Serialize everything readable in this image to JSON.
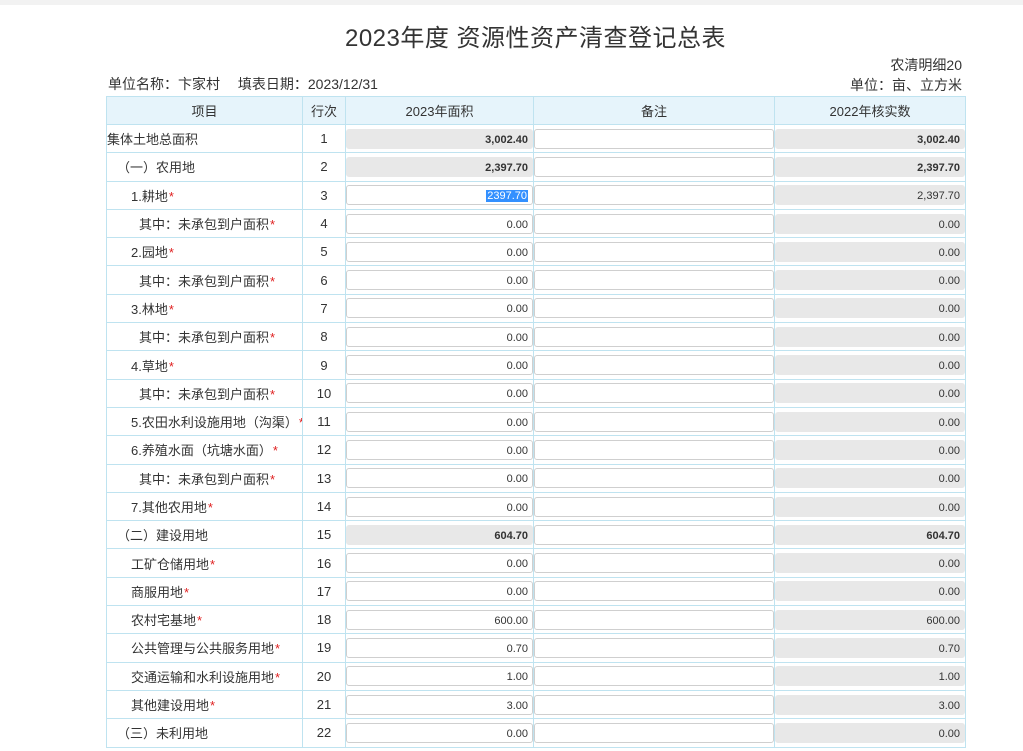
{
  "title": "2023年度 资源性资产清查登记总表",
  "form_code": "农清明细20",
  "unit_label": "单位：亩、立方米",
  "unit_name": "单位名称：卞家村",
  "fill_date": "填表日期：2023/12/31",
  "columns": [
    "项目",
    "行次",
    "2023年面积",
    "备注",
    "2022年核实数"
  ],
  "colors": {
    "header_bg": "#e6f4fb",
    "border": "#bfe3f0",
    "required_star": "#e02020",
    "selection": "#3390ff"
  },
  "rows": [
    {
      "label": "集体土地总面积",
      "level": 0,
      "required": false,
      "line": "1",
      "area": "3,002.40",
      "area_ro": true,
      "bold": true,
      "note": "",
      "prev": "3,002.40"
    },
    {
      "label": "（一）农用地",
      "level": 1,
      "required": false,
      "line": "2",
      "area": "2,397.70",
      "area_ro": true,
      "bold": true,
      "note": "",
      "prev": "2,397.70"
    },
    {
      "label": "1.耕地",
      "level": 2,
      "required": true,
      "line": "3",
      "area": "2397.70",
      "area_ro": false,
      "bold": false,
      "selected": true,
      "note": "",
      "prev": "2,397.70"
    },
    {
      "label": "其中：未承包到户面积",
      "level": 3,
      "required": true,
      "line": "4",
      "area": "0.00",
      "area_ro": false,
      "bold": false,
      "note": "",
      "prev": "0.00"
    },
    {
      "label": "2.园地",
      "level": 2,
      "required": true,
      "line": "5",
      "area": "0.00",
      "area_ro": false,
      "bold": false,
      "note": "",
      "prev": "0.00"
    },
    {
      "label": "其中：未承包到户面积",
      "level": 3,
      "required": true,
      "line": "6",
      "area": "0.00",
      "area_ro": false,
      "bold": false,
      "note": "",
      "prev": "0.00"
    },
    {
      "label": "3.林地",
      "level": 2,
      "required": true,
      "line": "7",
      "area": "0.00",
      "area_ro": false,
      "bold": false,
      "note": "",
      "prev": "0.00"
    },
    {
      "label": "其中：未承包到户面积",
      "level": 3,
      "required": true,
      "line": "8",
      "area": "0.00",
      "area_ro": false,
      "bold": false,
      "note": "",
      "prev": "0.00"
    },
    {
      "label": "4.草地",
      "level": 2,
      "required": true,
      "line": "9",
      "area": "0.00",
      "area_ro": false,
      "bold": false,
      "note": "",
      "prev": "0.00"
    },
    {
      "label": "其中：未承包到户面积",
      "level": 3,
      "required": true,
      "line": "10",
      "area": "0.00",
      "area_ro": false,
      "bold": false,
      "note": "",
      "prev": "0.00"
    },
    {
      "label": "5.农田水利设施用地（沟渠）",
      "level": 2,
      "required": true,
      "line": "11",
      "area": "0.00",
      "area_ro": false,
      "bold": false,
      "note": "",
      "prev": "0.00"
    },
    {
      "label": "6.养殖水面（坑塘水面）",
      "level": 2,
      "required": true,
      "line": "12",
      "area": "0.00",
      "area_ro": false,
      "bold": false,
      "note": "",
      "prev": "0.00"
    },
    {
      "label": "其中：未承包到户面积",
      "level": 3,
      "required": true,
      "line": "13",
      "area": "0.00",
      "area_ro": false,
      "bold": false,
      "note": "",
      "prev": "0.00"
    },
    {
      "label": "7.其他农用地",
      "level": 2,
      "required": true,
      "line": "14",
      "area": "0.00",
      "area_ro": false,
      "bold": false,
      "note": "",
      "prev": "0.00"
    },
    {
      "label": "（二）建设用地",
      "level": 1,
      "required": false,
      "line": "15",
      "area": "604.70",
      "area_ro": true,
      "bold": true,
      "note": "",
      "prev": "604.70"
    },
    {
      "label": "工矿仓储用地",
      "level": 2,
      "required": true,
      "line": "16",
      "area": "0.00",
      "area_ro": false,
      "bold": false,
      "note": "",
      "prev": "0.00"
    },
    {
      "label": "商服用地",
      "level": 2,
      "required": true,
      "line": "17",
      "area": "0.00",
      "area_ro": false,
      "bold": false,
      "note": "",
      "prev": "0.00"
    },
    {
      "label": "农村宅基地",
      "level": 2,
      "required": true,
      "line": "18",
      "area": "600.00",
      "area_ro": false,
      "bold": false,
      "note": "",
      "prev": "600.00"
    },
    {
      "label": "公共管理与公共服务用地",
      "level": 2,
      "required": true,
      "line": "19",
      "area": "0.70",
      "area_ro": false,
      "bold": false,
      "note": "",
      "prev": "0.70"
    },
    {
      "label": "交通运输和水利设施用地",
      "level": 2,
      "required": true,
      "line": "20",
      "area": "1.00",
      "area_ro": false,
      "bold": false,
      "note": "",
      "prev": "1.00"
    },
    {
      "label": "其他建设用地",
      "level": 2,
      "required": true,
      "line": "21",
      "area": "3.00",
      "area_ro": false,
      "bold": false,
      "note": "",
      "prev": "3.00"
    },
    {
      "label": "（三）未利用地",
      "level": 1,
      "required": false,
      "line": "22",
      "area": "0.00",
      "area_ro": false,
      "bold": false,
      "note": "",
      "prev": "0.00"
    }
  ]
}
